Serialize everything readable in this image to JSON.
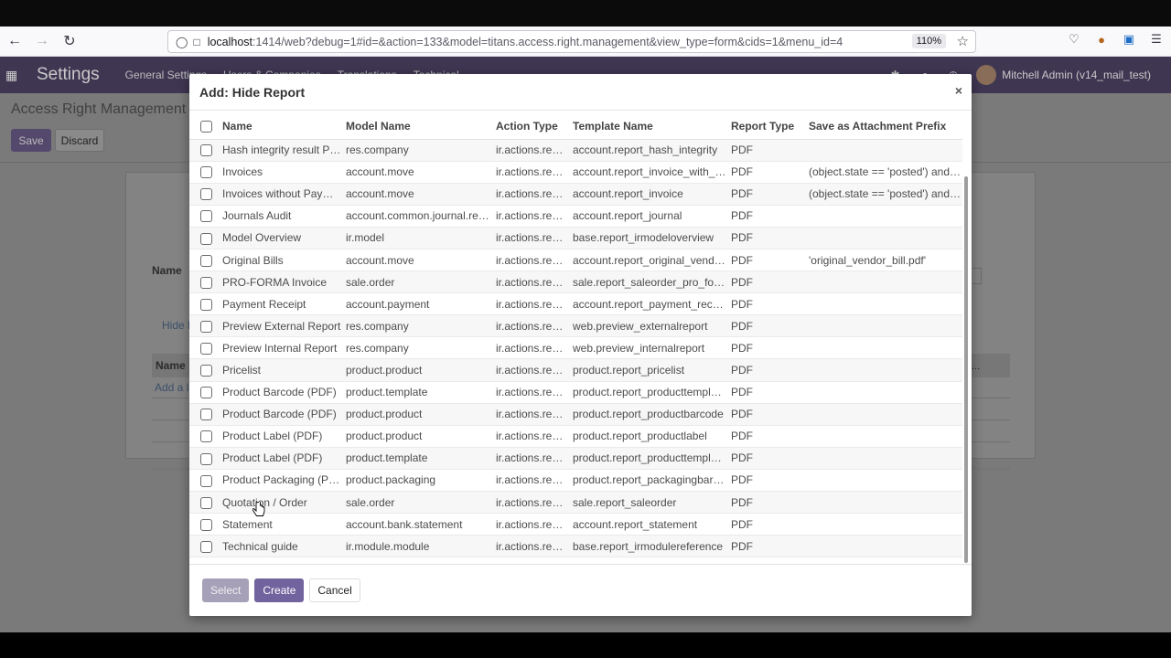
{
  "browser": {
    "url_host": "localhost",
    "url_rest": ":1414/web?debug=1#id=&action=133&model=titans.access.right.management&view_type=form&cids=1&menu_id=4",
    "zoom": "110%"
  },
  "odoo": {
    "app_title": "Settings",
    "menu": [
      "General Settings",
      "Users & Companies",
      "Translations",
      "Technical"
    ],
    "user": "Mitchell Admin (v14_mail_test)",
    "breadcrumb": "Access Right Management /",
    "save_label": "Save",
    "discard_label": "Discard",
    "name_label": "Name",
    "tab_label": "Hide M",
    "table_header": "Name",
    "add_line": "Add a li",
    "col_dots": "..."
  },
  "modal": {
    "title": "Add: Hide Report",
    "close": "×",
    "columns": [
      "Name",
      "Model Name",
      "Action Type",
      "Template Name",
      "Report Type",
      "Save as Attachment Prefix"
    ],
    "rows": [
      [
        "Hash integrity result PDF",
        "res.company",
        "ir.actions.report",
        "account.report_hash_integrity",
        "PDF",
        ""
      ],
      [
        "Invoices",
        "account.move",
        "ir.actions.report",
        "account.report_invoice_with_p...",
        "PDF",
        "(object.state == 'posted') and (..."
      ],
      [
        "Invoices without Payment",
        "account.move",
        "ir.actions.report",
        "account.report_invoice",
        "PDF",
        "(object.state == 'posted') and (..."
      ],
      [
        "Journals Audit",
        "account.common.journal.report",
        "ir.actions.report",
        "account.report_journal",
        "PDF",
        ""
      ],
      [
        "Model Overview",
        "ir.model",
        "ir.actions.report",
        "base.report_irmodeloverview",
        "PDF",
        ""
      ],
      [
        "Original Bills",
        "account.move",
        "ir.actions.report",
        "account.report_original_vendo...",
        "PDF",
        "'original_vendor_bill.pdf'"
      ],
      [
        "PRO-FORMA Invoice",
        "sale.order",
        "ir.actions.report",
        "sale.report_saleorder_pro_forma",
        "PDF",
        ""
      ],
      [
        "Payment Receipt",
        "account.payment",
        "ir.actions.report",
        "account.report_payment_receipt",
        "PDF",
        ""
      ],
      [
        "Preview External Report",
        "res.company",
        "ir.actions.report",
        "web.preview_externalreport",
        "PDF",
        ""
      ],
      [
        "Preview Internal Report",
        "res.company",
        "ir.actions.report",
        "web.preview_internalreport",
        "PDF",
        ""
      ],
      [
        "Pricelist",
        "product.product",
        "ir.actions.report",
        "product.report_pricelist",
        "PDF",
        ""
      ],
      [
        "Product Barcode (PDF)",
        "product.template",
        "ir.actions.report",
        "product.report_producttemplat...",
        "PDF",
        ""
      ],
      [
        "Product Barcode (PDF)",
        "product.product",
        "ir.actions.report",
        "product.report_productbarcode",
        "PDF",
        ""
      ],
      [
        "Product Label (PDF)",
        "product.product",
        "ir.actions.report",
        "product.report_productlabel",
        "PDF",
        ""
      ],
      [
        "Product Label (PDF)",
        "product.template",
        "ir.actions.report",
        "product.report_producttemplat...",
        "PDF",
        ""
      ],
      [
        "Product Packaging (PDF)",
        "product.packaging",
        "ir.actions.report",
        "product.report_packagingbarc...",
        "PDF",
        ""
      ],
      [
        "Quotation / Order",
        "sale.order",
        "ir.actions.report",
        "sale.report_saleorder",
        "PDF",
        ""
      ],
      [
        "Statement",
        "account.bank.statement",
        "ir.actions.report",
        "account.report_statement",
        "PDF",
        ""
      ],
      [
        "Technical guide",
        "ir.module.module",
        "ir.actions.report",
        "base.report_irmodulereference",
        "PDF",
        ""
      ]
    ],
    "select_label": "Select",
    "create_label": "Create",
    "cancel_label": "Cancel"
  },
  "colors": {
    "odoo_brand": "#71639e",
    "navbar": "#3f3652"
  }
}
